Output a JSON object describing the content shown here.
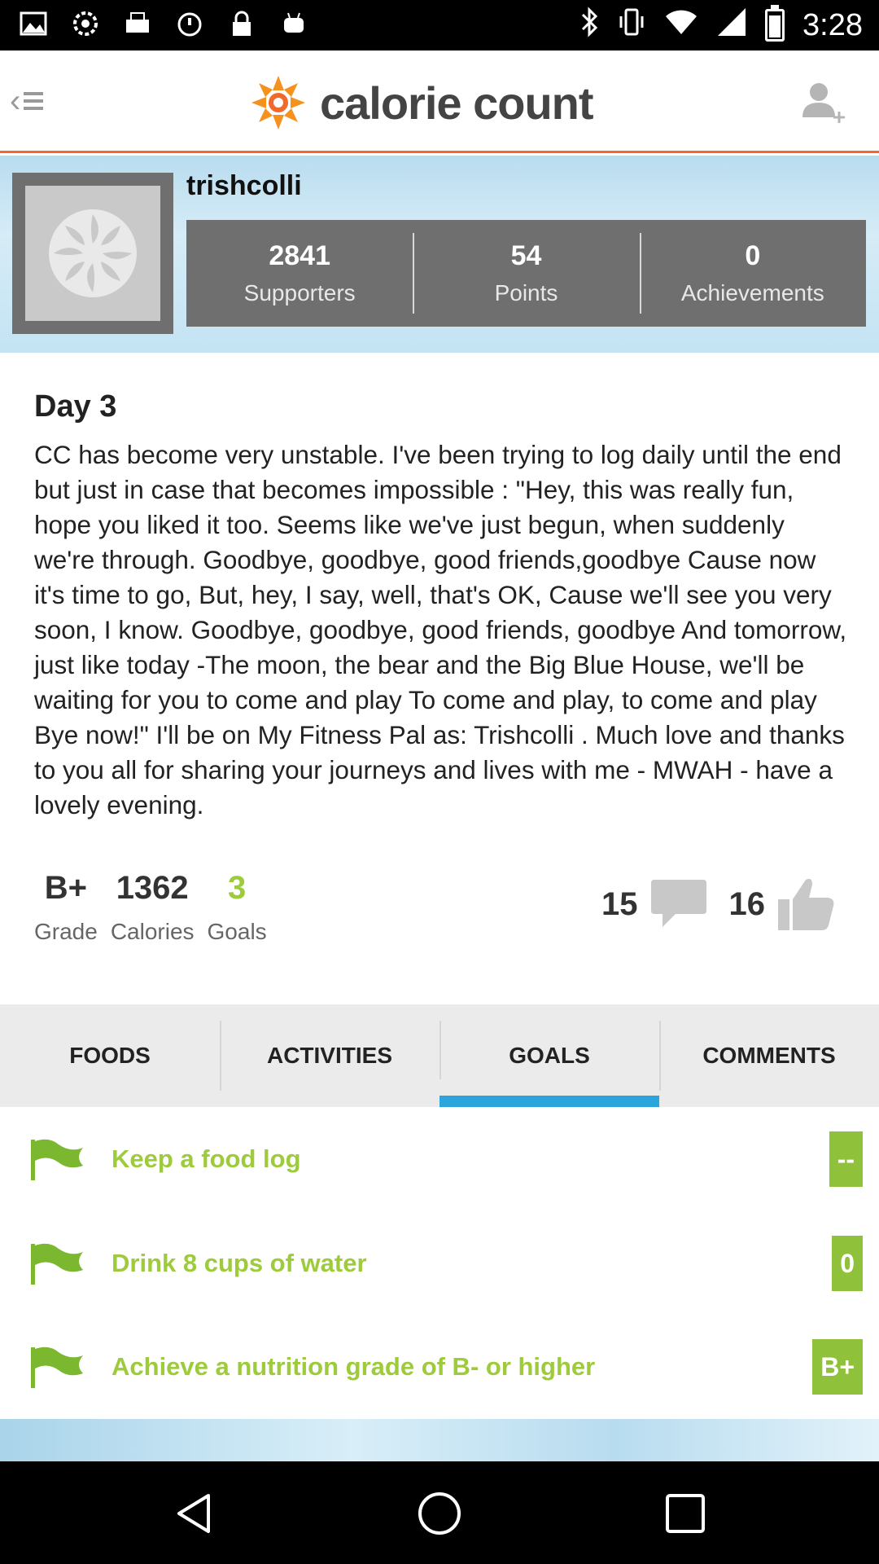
{
  "status_bar": {
    "time": "3:28",
    "left_icons": [
      "photo-icon",
      "settings-icon",
      "fax-icon",
      "alarm-icon",
      "lock-icon",
      "android-icon"
    ],
    "right_icons": [
      "bluetooth-icon",
      "vibrate-icon",
      "wifi-icon",
      "signal-icon",
      "battery-icon"
    ]
  },
  "header": {
    "brand": "calorie count",
    "brand_color": "#f06a2b"
  },
  "profile": {
    "username": "trishcolli",
    "stats": [
      {
        "value": "2841",
        "label": "Supporters"
      },
      {
        "value": "54",
        "label": "Points"
      },
      {
        "value": "0",
        "label": "Achievements"
      }
    ]
  },
  "post": {
    "title": "Day 3",
    "body": "CC has become very unstable. I've been trying to log daily until the end but just in case that becomes impossible : \"Hey, this was really fun, hope you liked it too. Seems like we've just begun, when suddenly we're through. Goodbye, goodbye, good friends,goodbye Cause now it's time to go, But, hey, I say, well, that's OK, Cause we'll see you very soon, I know. Goodbye, goodbye, good friends, goodbye And tomorrow, just like today -The moon, the bear and the Big Blue House, we'll be waiting for you to come and play To come and play, to come and play Bye now!\" I'll be on My Fitness Pal as: Trishcolli . Much love and thanks to you all for sharing your journeys and lives with me - MWAH - have a lovely evening."
  },
  "summary": {
    "grade": {
      "value": "B+",
      "label": "Grade"
    },
    "calories": {
      "value": "1362",
      "label": "Calories"
    },
    "goals": {
      "value": "3",
      "label": "Goals"
    },
    "comments_count": "15",
    "likes_count": "16"
  },
  "tabs": [
    {
      "label": "FOODS",
      "active": false
    },
    {
      "label": "ACTIVITIES",
      "active": false
    },
    {
      "label": "GOALS",
      "active": true
    },
    {
      "label": "COMMENTS",
      "active": false
    }
  ],
  "goals": [
    {
      "text": "Keep a food log",
      "badge": "--"
    },
    {
      "text": "Drink 8 cups of water",
      "badge": "0"
    },
    {
      "text": "Achieve a nutrition grade of B- or higher",
      "badge": "B+"
    }
  ],
  "colors": {
    "accent_green": "#9dcb3b",
    "badge_green": "#8fc23a",
    "tab_active": "#2ba5dc",
    "stats_bg": "#6f6f6f"
  }
}
